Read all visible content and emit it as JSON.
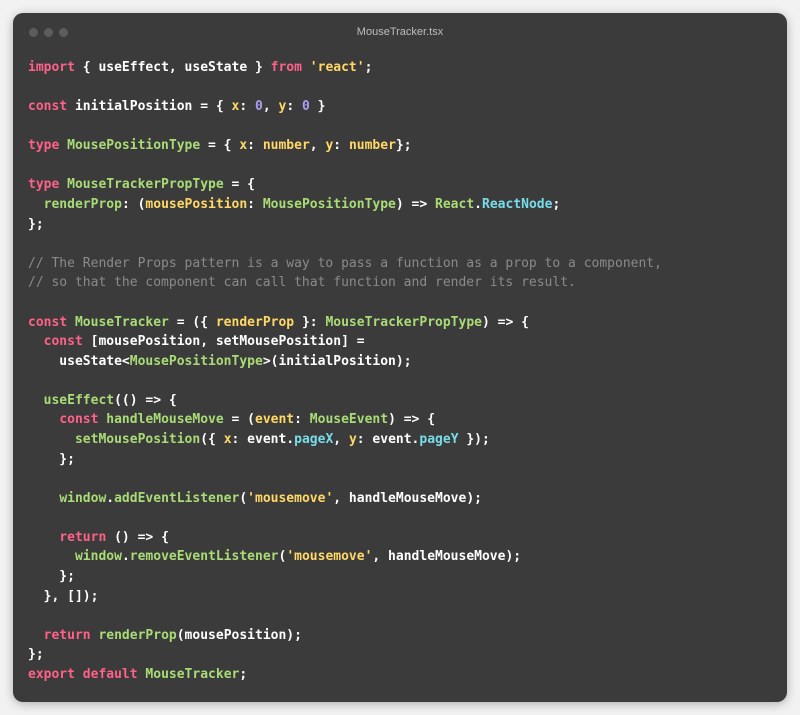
{
  "window": {
    "title": "MouseTracker.tsx",
    "traffic_lights": [
      "close",
      "minimize",
      "zoom"
    ]
  },
  "palette": {
    "keyword": "#ff6188",
    "function": "#a9dc76",
    "string": "#ffd866",
    "number": "#ab9df2",
    "property": "#78dce8",
    "comment": "#8a8a8a",
    "plain": "#ffffff",
    "background": "#3b3b3b"
  },
  "code": {
    "language": "tsx",
    "lines": [
      [
        [
          "keyword",
          "import"
        ],
        [
          "plain",
          " { "
        ],
        [
          "plain",
          "useEffect, useState"
        ],
        [
          "plain",
          " } "
        ],
        [
          "keyword",
          "from"
        ],
        [
          "plain",
          " "
        ],
        [
          "string",
          "'react'"
        ],
        [
          "plain",
          ";"
        ]
      ],
      [],
      [
        [
          "keyword",
          "const"
        ],
        [
          "plain",
          " initialPosition = { "
        ],
        [
          "param",
          "x"
        ],
        [
          "plain",
          ": "
        ],
        [
          "number",
          "0"
        ],
        [
          "plain",
          ", "
        ],
        [
          "param",
          "y"
        ],
        [
          "plain",
          ": "
        ],
        [
          "number",
          "0"
        ],
        [
          "plain",
          " }"
        ]
      ],
      [],
      [
        [
          "keyword",
          "type"
        ],
        [
          "plain",
          " "
        ],
        [
          "type",
          "MousePositionType"
        ],
        [
          "plain",
          " = { "
        ],
        [
          "param",
          "x"
        ],
        [
          "plain",
          ": "
        ],
        [
          "param",
          "number"
        ],
        [
          "plain",
          ", "
        ],
        [
          "param",
          "y"
        ],
        [
          "plain",
          ": "
        ],
        [
          "param",
          "number"
        ],
        [
          "plain",
          "};"
        ]
      ],
      [],
      [
        [
          "keyword",
          "type"
        ],
        [
          "plain",
          " "
        ],
        [
          "type",
          "MouseTrackerPropType"
        ],
        [
          "plain",
          " = {"
        ]
      ],
      [
        [
          "plain",
          "  "
        ],
        [
          "type",
          "renderProp"
        ],
        [
          "plain",
          ": ("
        ],
        [
          "param",
          "mousePosition"
        ],
        [
          "plain",
          ": "
        ],
        [
          "type",
          "MousePositionType"
        ],
        [
          "plain",
          ") => "
        ],
        [
          "type",
          "React"
        ],
        [
          "plain",
          "."
        ],
        [
          "prop",
          "ReactNode"
        ],
        [
          "plain",
          ";"
        ]
      ],
      [
        [
          "plain",
          "};"
        ]
      ],
      [],
      [
        [
          "comment",
          "// The Render Props pattern is a way to pass a function as a prop to a component,"
        ]
      ],
      [
        [
          "comment",
          "// so that the component can call that function and render its result."
        ]
      ],
      [],
      [
        [
          "keyword",
          "const"
        ],
        [
          "plain",
          " "
        ],
        [
          "fn",
          "MouseTracker"
        ],
        [
          "plain",
          " = ({ "
        ],
        [
          "param",
          "renderProp"
        ],
        [
          "plain",
          " }: "
        ],
        [
          "type",
          "MouseTrackerPropType"
        ],
        [
          "plain",
          ") => {"
        ]
      ],
      [
        [
          "plain",
          "  "
        ],
        [
          "keyword",
          "const"
        ],
        [
          "plain",
          " [mousePosition, setMousePosition] ="
        ]
      ],
      [
        [
          "plain",
          "    useState<"
        ],
        [
          "type",
          "MousePositionType"
        ],
        [
          "plain",
          ">(initialPosition);"
        ]
      ],
      [],
      [
        [
          "plain",
          "  "
        ],
        [
          "fn",
          "useEffect"
        ],
        [
          "plain",
          "(() => {"
        ]
      ],
      [
        [
          "plain",
          "    "
        ],
        [
          "keyword",
          "const"
        ],
        [
          "plain",
          " "
        ],
        [
          "fn",
          "handleMouseMove"
        ],
        [
          "plain",
          " = ("
        ],
        [
          "param",
          "event"
        ],
        [
          "plain",
          ": "
        ],
        [
          "type",
          "MouseEvent"
        ],
        [
          "plain",
          ") => {"
        ]
      ],
      [
        [
          "plain",
          "      "
        ],
        [
          "fn",
          "setMousePosition"
        ],
        [
          "plain",
          "({ "
        ],
        [
          "param",
          "x"
        ],
        [
          "plain",
          ": event."
        ],
        [
          "prop",
          "pageX"
        ],
        [
          "plain",
          ", "
        ],
        [
          "param",
          "y"
        ],
        [
          "plain",
          ": event."
        ],
        [
          "prop",
          "pageY"
        ],
        [
          "plain",
          " });"
        ]
      ],
      [
        [
          "plain",
          "    };"
        ]
      ],
      [],
      [
        [
          "plain",
          "    "
        ],
        [
          "fn",
          "window"
        ],
        [
          "plain",
          "."
        ],
        [
          "fn",
          "addEventListener"
        ],
        [
          "plain",
          "("
        ],
        [
          "string",
          "'mousemove'"
        ],
        [
          "plain",
          ", handleMouseMove);"
        ]
      ],
      [],
      [
        [
          "plain",
          "    "
        ],
        [
          "keyword",
          "return"
        ],
        [
          "plain",
          " () => {"
        ]
      ],
      [
        [
          "plain",
          "      "
        ],
        [
          "fn",
          "window"
        ],
        [
          "plain",
          "."
        ],
        [
          "fn",
          "removeEventListener"
        ],
        [
          "plain",
          "("
        ],
        [
          "string",
          "'mousemove'"
        ],
        [
          "plain",
          ", handleMouseMove);"
        ]
      ],
      [
        [
          "plain",
          "    };"
        ]
      ],
      [
        [
          "plain",
          "  }, []);"
        ]
      ],
      [],
      [
        [
          "plain",
          "  "
        ],
        [
          "keyword",
          "return"
        ],
        [
          "plain",
          " "
        ],
        [
          "fn",
          "renderProp"
        ],
        [
          "plain",
          "(mousePosition);"
        ]
      ],
      [
        [
          "plain",
          "};"
        ]
      ],
      [
        [
          "keyword",
          "export"
        ],
        [
          "plain",
          " "
        ],
        [
          "keyword",
          "default"
        ],
        [
          "plain",
          " "
        ],
        [
          "fn",
          "MouseTracker"
        ],
        [
          "plain",
          ";"
        ]
      ]
    ]
  }
}
